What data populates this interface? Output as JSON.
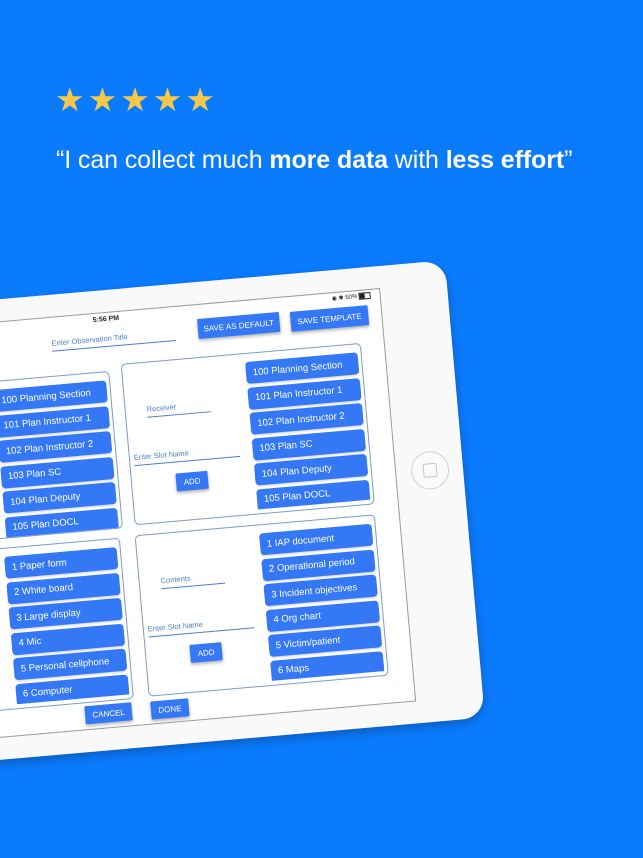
{
  "review": {
    "stars": 5,
    "star_color": "#f5c84a",
    "quote_open": "“I can collect much ",
    "quote_bold1": "more data",
    "quote_mid": " with ",
    "quote_bold2": "less effort",
    "quote_close": "”"
  },
  "status_bar": {
    "time": "5:56 PM",
    "battery": "50%"
  },
  "header": {
    "title_placeholder": "Enter Observation Title",
    "save_default": "SAVE AS DEFAULT",
    "save_template": "SAVE TEMPLATE"
  },
  "panels": {
    "top_left": {
      "items": [
        "100 Planning Section",
        "101 Plan Instructor 1",
        "102 Plan Instructor 2",
        "103 Plan SC",
        "104 Plan Deputy",
        "105 Plan DOCL"
      ]
    },
    "receiver": {
      "label": "Receiver",
      "slot_placeholder": "Enter Slot Name",
      "add": "ADD",
      "items": [
        "100 Planning Section",
        "101 Plan Instructor 1",
        "102 Plan Instructor 2",
        "103 Plan SC",
        "104 Plan Deputy",
        "105 Plan DOCL"
      ]
    },
    "bottom_left": {
      "items": [
        "1 Paper form",
        "2 White board",
        "3 Large display",
        "4 Mic",
        "5 Personal cellphone",
        "6 Computer"
      ]
    },
    "contents": {
      "label": "Contents",
      "slot_placeholder": "Enter Slot Name",
      "add": "ADD",
      "items": [
        "1 IAP document",
        "2 Operational period",
        "3 Incident objectives",
        "4 Org chart",
        "5 Victim/patient",
        "6 Maps"
      ]
    }
  },
  "footer": {
    "cancel": "CANCEL",
    "done": "DONE"
  },
  "colors": {
    "background": "#0b7bfe",
    "button": "#3478f6"
  }
}
